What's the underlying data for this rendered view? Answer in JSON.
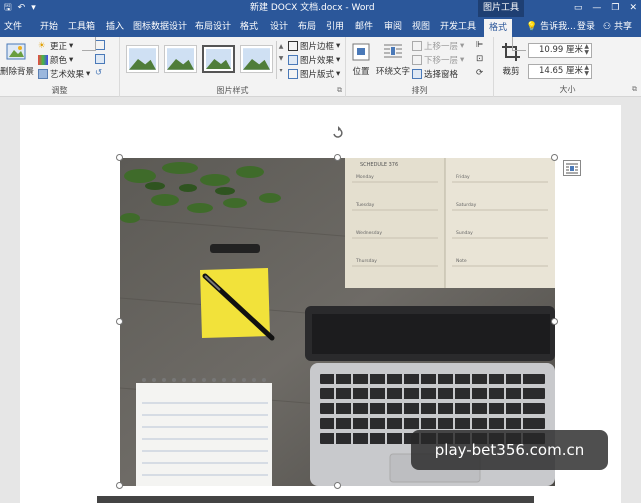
{
  "titlebar": {
    "qat": {
      "save": "🖫",
      "undo": "↶",
      "more": "▾"
    },
    "title": "新建 DOCX 文档.docx - Word",
    "context_tool": "图片工具",
    "controls": {
      "ribbon_options": "▭",
      "minimize": "—",
      "restore": "❐",
      "close": "✕"
    }
  },
  "tabs": [
    "文件",
    "开始",
    "工具箱",
    "插入",
    "图标数据设计",
    "布局设计",
    "格式",
    "设计",
    "布局",
    "引用",
    "邮件",
    "审阅",
    "视图",
    "开发工具",
    "格式"
  ],
  "active_tab_index": 14,
  "tell_me": "告诉我...",
  "login": "登录",
  "share": "共享",
  "ribbon": {
    "adjust": {
      "remove_bg": "删除背景",
      "corrections": "更正",
      "color": "颜色",
      "artistic": "艺术效果",
      "label": "调整"
    },
    "styles": {
      "border": "图片边框",
      "effects": "图片效果",
      "layout": "图片版式",
      "label": "图片样式"
    },
    "arrange": {
      "position": "位置",
      "wrap": "环绕文字",
      "forward": "上移一层",
      "backward": "下移一层",
      "pane": "选择窗格",
      "label": "排列"
    },
    "size": {
      "crop": "裁剪",
      "height": "10.99 厘米",
      "width": "14.65 厘米",
      "label": "大小"
    }
  },
  "photo": {
    "planner_title": "SCHEDULE 376",
    "planner_days_left": [
      "Monday",
      "Tuesday",
      "Wednesday",
      "Thursday"
    ],
    "planner_days_right": [
      "Friday",
      "Saturday",
      "Sunday",
      "Note"
    ]
  },
  "watermark": "play-bet356.com.cn",
  "colors": {
    "brand": "#2b579a",
    "ribbon": "#f3f3f3",
    "page": "#ffffff",
    "canvas": "#e6e6e6"
  }
}
